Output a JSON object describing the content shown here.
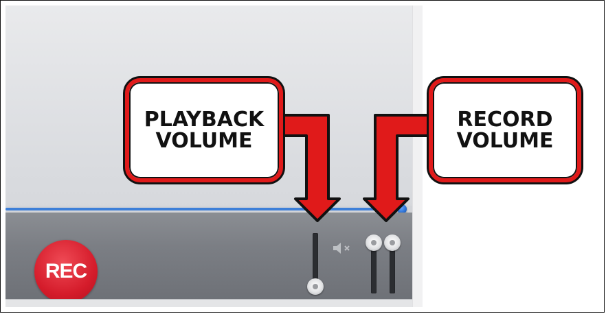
{
  "player": {
    "rec_label": "REC",
    "progress": 1.0,
    "playback_volume": 0.0,
    "record_volume_left": 1.0,
    "record_volume_right": 1.0,
    "colors": {
      "rec": "#d51c2b",
      "progress": "#3d7fd8",
      "controls_bg": "#7b7e84"
    },
    "icons": {
      "speaker": "speaker-muted-icon"
    }
  },
  "callouts": {
    "playback": {
      "line1": "PLAYBACK",
      "line2": "VOLUME"
    },
    "record": {
      "line1": "RECORD",
      "line2": "VOLUME"
    },
    "colors": {
      "border": "#e01a1a",
      "outline": "#111111"
    }
  }
}
